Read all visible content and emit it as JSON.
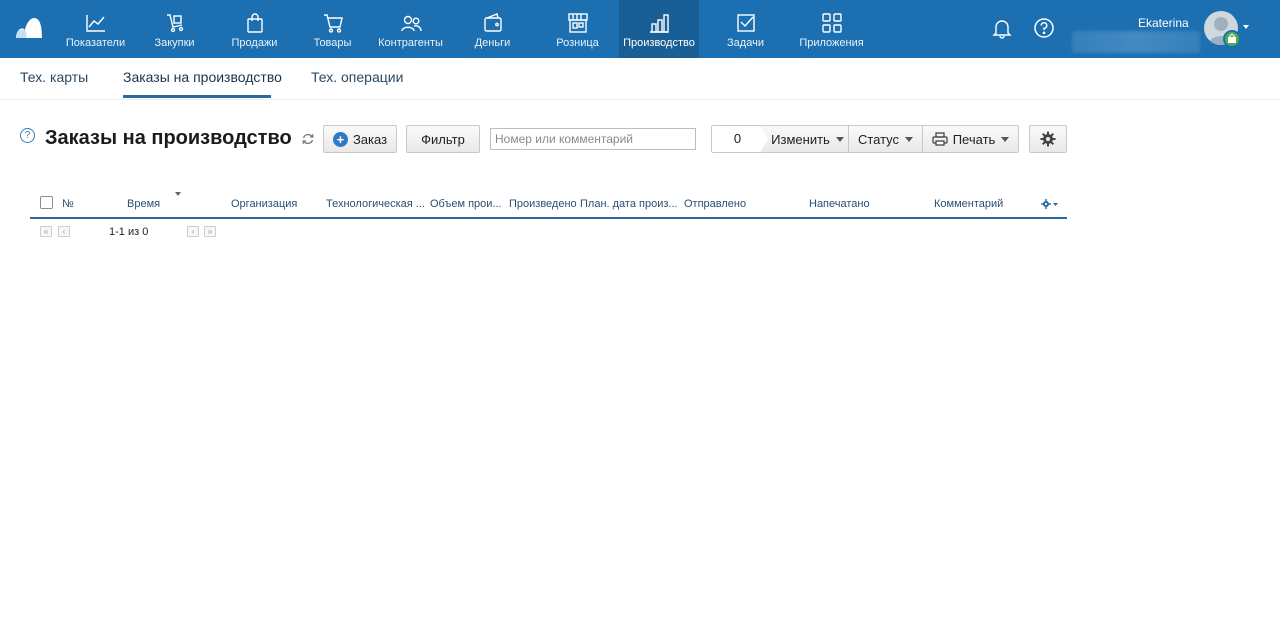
{
  "nav": {
    "items": [
      {
        "label": "Показатели",
        "icon": "chart-line-icon"
      },
      {
        "label": "Закупки",
        "icon": "cart-hand-icon"
      },
      {
        "label": "Продажи",
        "icon": "shopping-bag-icon"
      },
      {
        "label": "Товары",
        "icon": "cart-icon"
      },
      {
        "label": "Контрагенты",
        "icon": "people-icon"
      },
      {
        "label": "Деньги",
        "icon": "wallet-icon"
      },
      {
        "label": "Розница",
        "icon": "store-icon"
      },
      {
        "label": "Производство",
        "icon": "factory-icon"
      },
      {
        "label": "Задачи",
        "icon": "checkbox-icon"
      },
      {
        "label": "Приложения",
        "icon": "apps-icon"
      }
    ],
    "active": "Производство"
  },
  "user": {
    "name": "Ekaterina"
  },
  "subtabs": [
    "Тех. карты",
    "Заказы на производство",
    "Тех. операции"
  ],
  "page": {
    "title": "Заказы на производство",
    "help": "?"
  },
  "toolbar": {
    "order_label": "Заказ",
    "filter_label": "Фильтр",
    "search_placeholder": "Номер или комментарий",
    "selected_count": "0",
    "change_label": "Изменить",
    "status_label": "Статус",
    "print_label": "Печать"
  },
  "table": {
    "columns": [
      "№",
      "Время",
      "Организация",
      "Технологическая ...",
      "Объем прои...",
      "Произведено",
      "План. дата произ...",
      "Отправлено",
      "Напечатано",
      "Комментарий"
    ]
  },
  "pager": {
    "text": "1-1 из 0"
  },
  "colors": {
    "topbar": "#1c6fb0",
    "accent": "#2a6aa0"
  }
}
